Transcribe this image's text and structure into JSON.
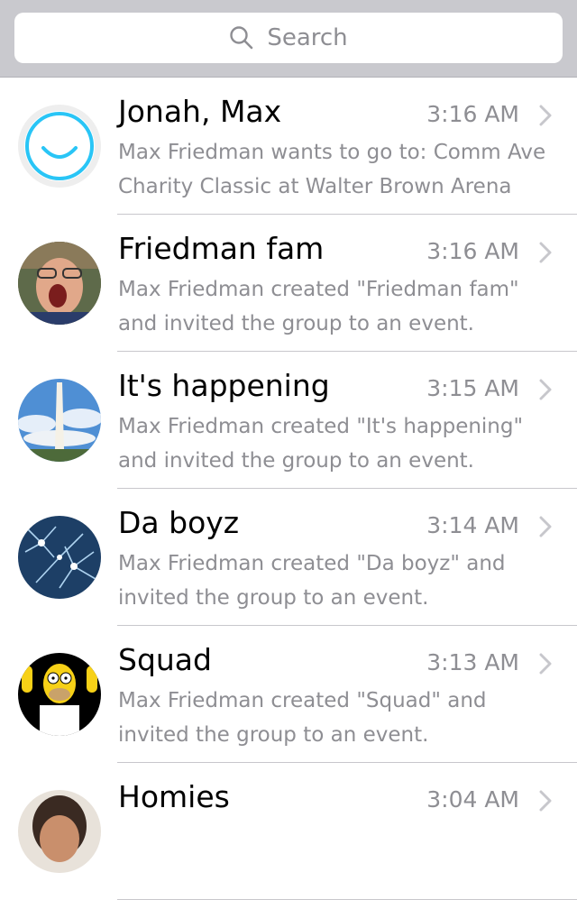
{
  "search": {
    "placeholder": "Search"
  },
  "conversations": [
    {
      "title": "Jonah, Max",
      "time": "3:16 AM",
      "preview": "Max Friedman wants to go to: Comm Ave Charity Classic at Walter Brown Arena",
      "avatar": "smiley-logo"
    },
    {
      "title": "Friedman fam",
      "time": "3:16 AM",
      "preview": "Max Friedman created \"Friedman fam\" and invited the group to an event.",
      "avatar": "person-photo"
    },
    {
      "title": "It's happening",
      "time": "3:15 AM",
      "preview": "Max Friedman created \"It's happening\" and invited the group to an event.",
      "avatar": "monument-photo"
    },
    {
      "title": "Da boyz",
      "time": "3:14 AM",
      "preview": "Max Friedman created \"Da boyz\" and invited the group to an event.",
      "avatar": "fireworks-photo"
    },
    {
      "title": "Squad",
      "time": "3:13 AM",
      "preview": "Max Friedman created \"Squad\" and invited the group to an event.",
      "avatar": "cartoon-character"
    },
    {
      "title": "Homies",
      "time": "3:04 AM",
      "preview": "",
      "avatar": "person-photo"
    }
  ],
  "colors": {
    "accent": "#29c5f6",
    "secondary_text": "#8e8e93",
    "separator": "#c8c7cc",
    "search_bar_bg": "#c9c9ce"
  }
}
